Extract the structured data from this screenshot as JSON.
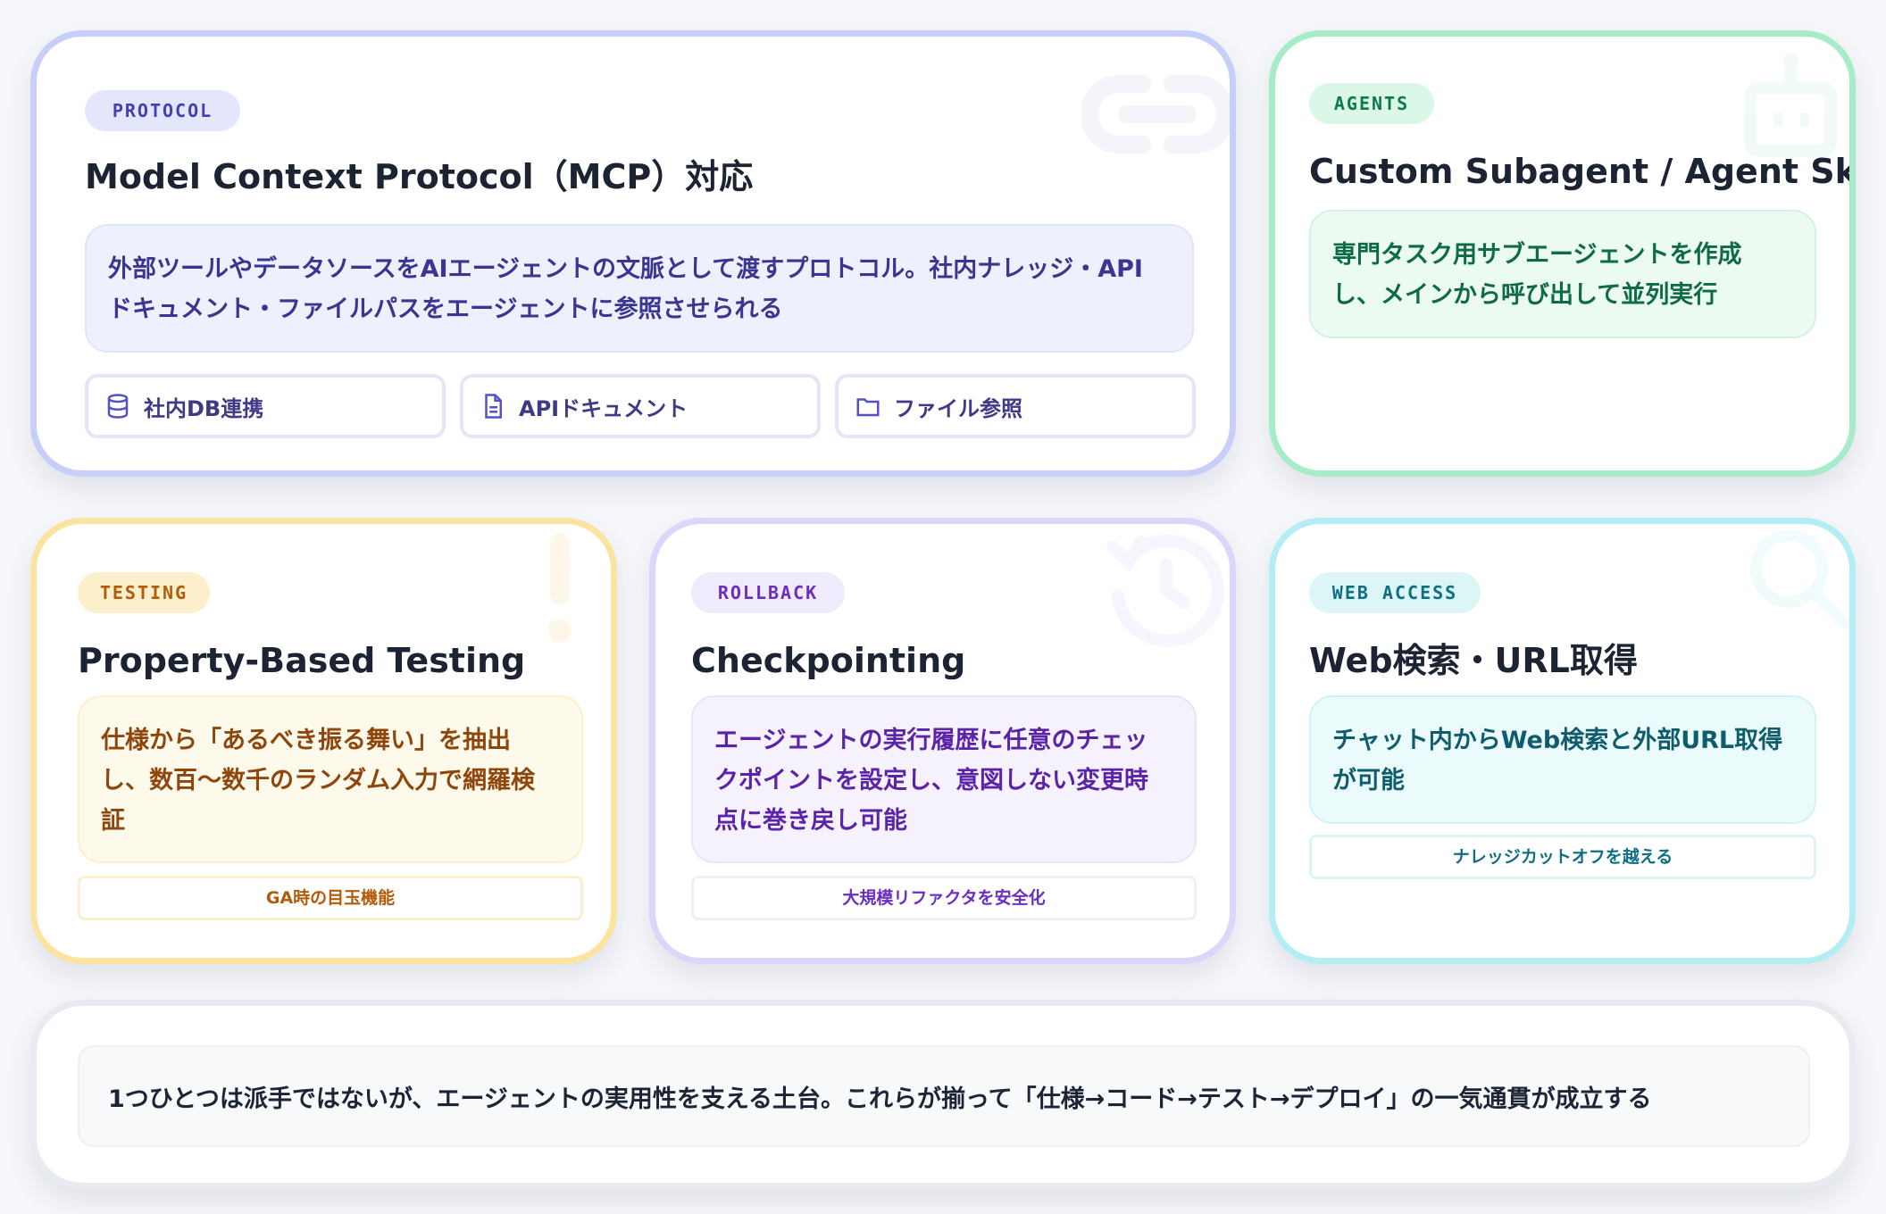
{
  "cards": {
    "mcp": {
      "badge": "PROTOCOL",
      "title": "Model Context Protocol（MCP）対応",
      "desc_line1": "外部ツールやデータソースをAIエージェントの文脈として渡すプロトコル。社内ナレッジ・API",
      "desc_line2": "ドキュメント・ファイルパスをエージェントに参照させられる",
      "chips": [
        {
          "label": "社内DB連携",
          "icon": "database-icon"
        },
        {
          "label": "APIドキュメント",
          "icon": "document-icon"
        },
        {
          "label": "ファイル参照",
          "icon": "folder-icon"
        }
      ],
      "bg_icon": "link-icon",
      "accent": "#c7cef9"
    },
    "agents": {
      "badge": "AGENTS",
      "title": "Custom Subagent / Agent Skills",
      "desc_line1": "専門タスク用サブエージェントを作成",
      "desc_line2": "し、メインから呼び出して並列実行",
      "bg_icon": "robot-icon",
      "accent": "#a7ecc8"
    },
    "testing": {
      "badge": "TESTING",
      "title": "Property-Based Testing",
      "desc_line1": "仕様から「あるべき振る舞い」を抽出",
      "desc_line2": "し、数百〜数千のランダム入力で網羅検",
      "desc_line3": "証",
      "tag": "GA時の目玉機能",
      "bg_icon": "exclamation-icon",
      "accent": "#fbe3a0"
    },
    "rollback": {
      "badge": "ROLLBACK",
      "title": "Checkpointing",
      "desc_line1": "エージェントの実行履歴に任意のチェッ",
      "desc_line2": "クポイントを設定し、意図しない変更時",
      "desc_line3": "点に巻き戻し可能",
      "tag": "大規模リファクタを安全化",
      "bg_icon": "history-icon",
      "accent": "#ddd6fa"
    },
    "web": {
      "badge": "WEB ACCESS",
      "title": "Web検索・URL取得",
      "desc_line1": "チャット内からWeb検索と外部URL取得",
      "desc_line2": "が可能",
      "tag": "ナレッジカットオフを越える",
      "bg_icon": "search-icon",
      "accent": "#b4eef4"
    }
  },
  "summary": {
    "text": "1つひとつは派手ではないが、エージェントの実用性を支える土台。これらが揃って「仕様→コード→テスト→デプロイ」の一気通貫が成立する"
  }
}
